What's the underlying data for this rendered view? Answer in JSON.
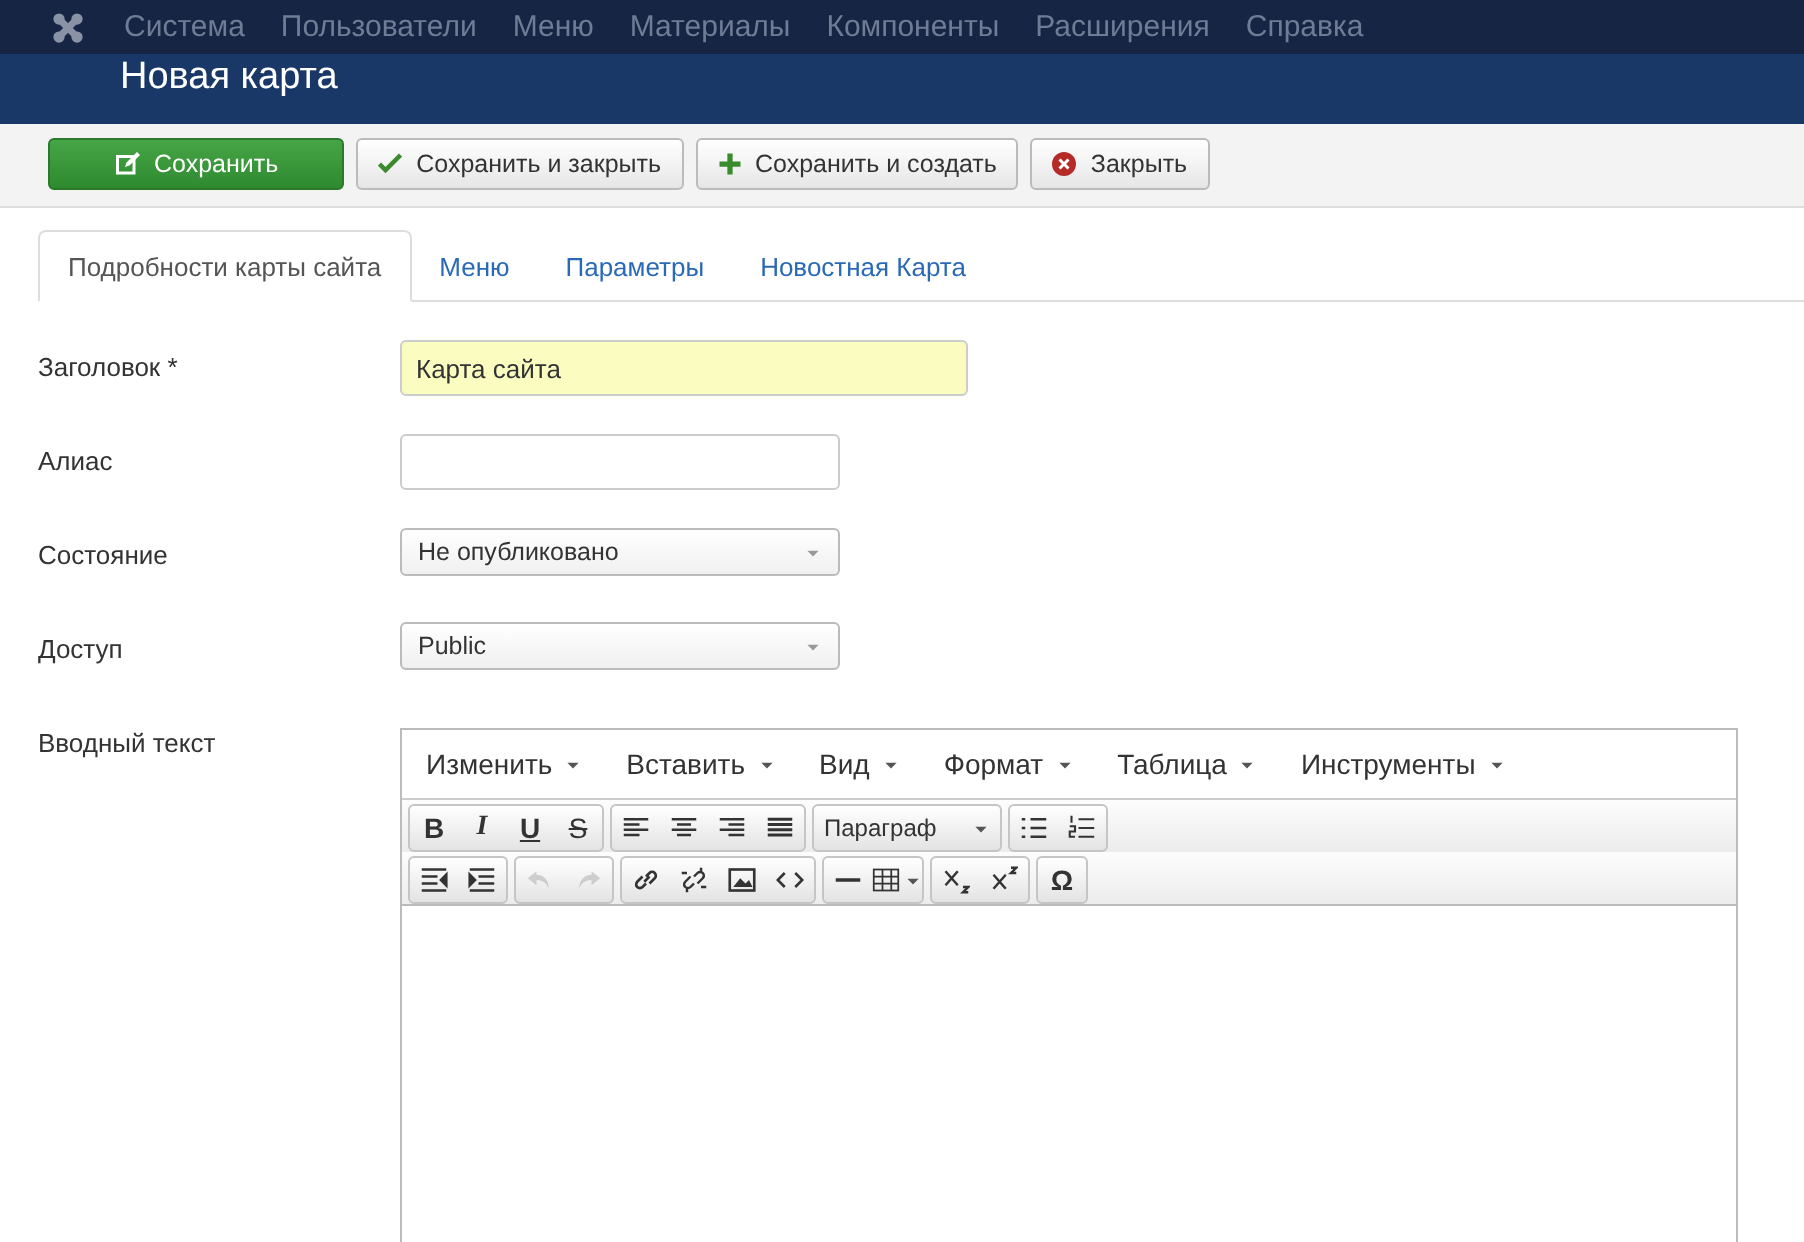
{
  "navbar": {
    "items": [
      "Система",
      "Пользователи",
      "Меню",
      "Материалы",
      "Компоненты",
      "Расширения",
      "Справка"
    ]
  },
  "header": {
    "title": "Новая карта"
  },
  "toolbar": [
    {
      "kind": "save",
      "label": "Сохранить"
    },
    {
      "kind": "check",
      "label": "Сохранить и закрыть"
    },
    {
      "kind": "new",
      "label": "Сохранить и создать"
    },
    {
      "kind": "close",
      "label": "Закрыть"
    }
  ],
  "tabs": [
    {
      "label": "Подробности карты сайта",
      "selected": true
    },
    {
      "label": "Меню",
      "selected": false
    },
    {
      "label": "Параметры",
      "selected": false
    },
    {
      "label": "Новостная Карта",
      "selected": false
    }
  ],
  "fields": [
    {
      "kind": "text",
      "label": "Заголовок *",
      "value": "Карта сайта",
      "required": true
    },
    {
      "kind": "text",
      "label": "Алиас",
      "required": false
    },
    {
      "kind": "select",
      "label": "Состояние",
      "value": "Не опубликовано"
    },
    {
      "kind": "select",
      "label": "Доступ",
      "value": "Public"
    },
    {
      "kind": "editor",
      "label": "Вводный текст"
    }
  ],
  "editor": {
    "menus": [
      "Изменить",
      "Вставить",
      "Вид",
      "Формат",
      "Таблица",
      "Инструменты"
    ],
    "rows": [
      [
        [
          {
            "kind": "text",
            "label": "B"
          },
          {
            "kind": "text",
            "label": "I"
          },
          {
            "kind": "text",
            "label": "U"
          },
          {
            "kind": "text",
            "label": "S"
          }
        ],
        [
          {
            "kind": "icon"
          },
          {
            "kind": "icon"
          },
          {
            "kind": "icon"
          },
          {
            "kind": "icon"
          }
        ],
        [
          {
            "kind": "select",
            "label": "Параграф"
          }
        ],
        [
          {
            "kind": "icon"
          },
          {
            "kind": "icon"
          }
        ]
      ],
      [
        [
          {
            "kind": "icon"
          },
          {
            "kind": "icon"
          }
        ],
        [
          {
            "kind": "icon",
            "disabled": true
          },
          {
            "kind": "icon",
            "disabled": true
          }
        ],
        [
          {
            "kind": "icon"
          },
          {
            "kind": "icon"
          },
          {
            "kind": "icon"
          },
          {
            "kind": "icon"
          }
        ],
        [
          {
            "kind": "icon"
          },
          {
            "kind": "icon"
          }
        ],
        [
          {
            "kind": "icon"
          },
          {
            "kind": "icon"
          }
        ],
        [
          {
            "kind": "text",
            "label": "Ω"
          }
        ]
      ]
    ]
  }
}
